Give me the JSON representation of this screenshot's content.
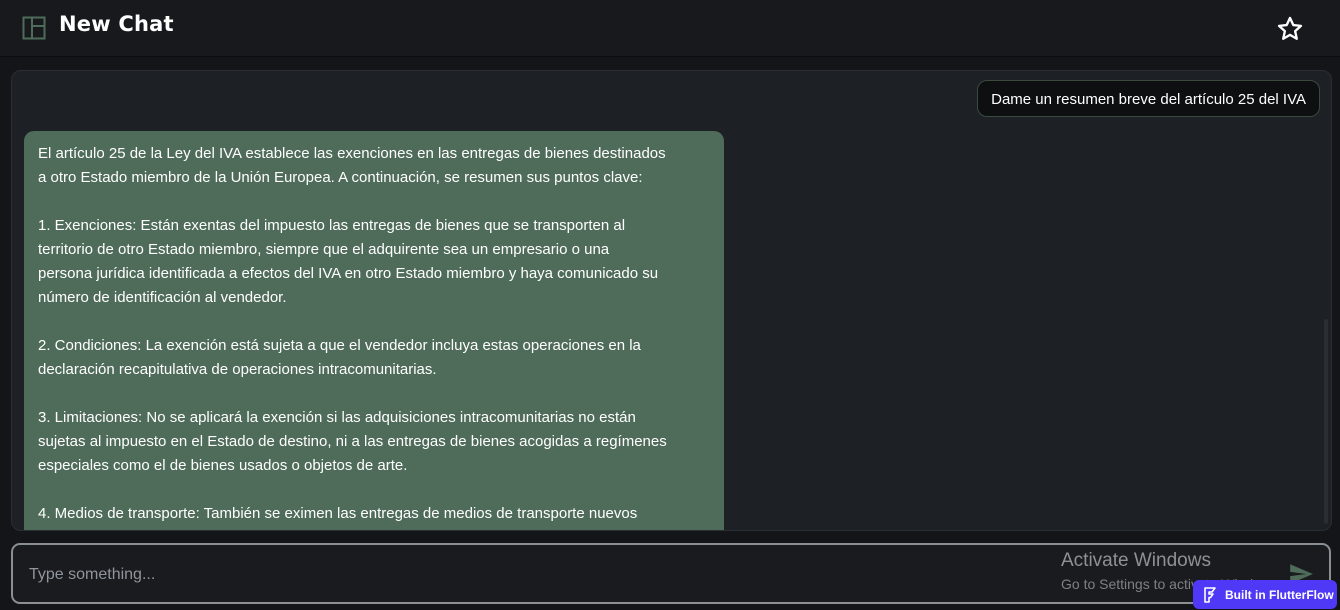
{
  "header": {
    "title": "New Chat",
    "menu_icon": "sidebar-layout-icon",
    "favorite_icon": "star-outline-icon"
  },
  "chat": {
    "messages": [
      {
        "role": "user",
        "text": "Dame un resumen breve del artículo 25 del IVA"
      },
      {
        "role": "assistant",
        "text": "El artículo 25 de la Ley del IVA establece las exenciones en las entregas de bienes destinados\na otro Estado miembro de la Unión Europea. A continuación, se resumen sus puntos clave:\n\n1. Exenciones: Están exentas del impuesto las entregas de bienes que se transporten al\nterritorio de otro Estado miembro, siempre que el adquirente sea un empresario o una\npersona jurídica identificada a efectos del IVA en otro Estado miembro y haya comunicado su\nnúmero de identificación al vendedor.\n\n2. Condiciones: La exención está sujeta a que el vendedor incluya estas operaciones en la\ndeclaración recapitulativa de operaciones intracomunitarias.\n\n3. Limitaciones: No se aplicará la exención si las adquisiciones intracomunitarias no están\nsujetas al impuesto en el Estado de destino, ni a las entregas de bienes acogidas a regímenes\nespeciales como el de bienes usados o objetos de arte.\n\n4. Medios de transporte: También se eximen las entregas de medios de transporte nuevos"
      }
    ]
  },
  "composer": {
    "placeholder": "Type something...",
    "value": "",
    "send_icon": "send-icon"
  },
  "watermark": {
    "title": "Activate Windows",
    "subtitle": "Go to Settings to activate Windows."
  },
  "badge": {
    "label": "Built in FlutterFlow",
    "icon": "flutterflow-logo-icon"
  },
  "colors": {
    "background": "#131518",
    "assistant_bubble": "#4f6b5a",
    "send_accent": "#4f6b5a",
    "badge": "#4f39f6"
  }
}
